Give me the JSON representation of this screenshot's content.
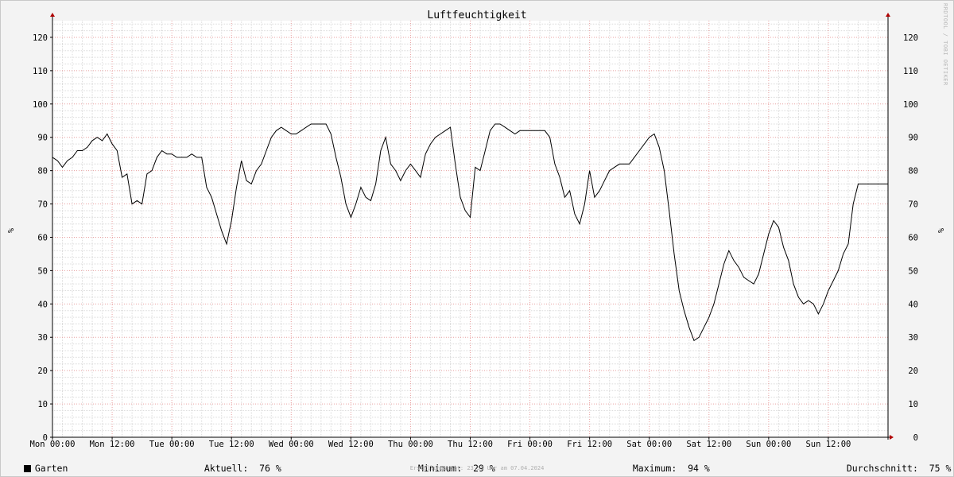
{
  "chart_data": {
    "type": "line",
    "title": "Luftfeuchtigkeit",
    "ylabel": "%",
    "xlabel": "",
    "ylim": [
      0,
      125
    ],
    "y_ticks": [
      0,
      10,
      20,
      30,
      40,
      50,
      60,
      70,
      80,
      90,
      100,
      110,
      120
    ],
    "x_ticks": [
      "Mon 00:00",
      "Mon 12:00",
      "Tue 00:00",
      "Tue 12:00",
      "Wed 00:00",
      "Wed 12:00",
      "Thu 00:00",
      "Thu 12:00",
      "Fri 00:00",
      "Fri 12:00",
      "Sat 00:00",
      "Sat 12:00",
      "Sun 00:00",
      "Sun 12:00"
    ],
    "x_unit": "hours since Mon 00:00",
    "xlim": [
      0,
      168
    ],
    "grid": true,
    "series": [
      {
        "name": "Garten",
        "color": "#000000",
        "x": [
          0,
          1,
          2,
          3,
          4,
          5,
          6,
          7,
          8,
          9,
          10,
          11,
          12,
          13,
          14,
          15,
          16,
          17,
          18,
          19,
          20,
          21,
          22,
          23,
          24,
          25,
          26,
          27,
          28,
          29,
          30,
          31,
          32,
          33,
          34,
          35,
          36,
          37,
          38,
          39,
          40,
          41,
          42,
          43,
          44,
          45,
          46,
          47,
          48,
          49,
          50,
          51,
          52,
          53,
          54,
          55,
          56,
          57,
          58,
          59,
          60,
          61,
          62,
          63,
          64,
          65,
          66,
          67,
          68,
          69,
          70,
          71,
          72,
          73,
          74,
          75,
          76,
          77,
          78,
          79,
          80,
          81,
          82,
          83,
          84,
          85,
          86,
          87,
          88,
          89,
          90,
          91,
          92,
          93,
          94,
          95,
          96,
          97,
          98,
          99,
          100,
          101,
          102,
          103,
          104,
          105,
          106,
          107,
          108,
          109,
          110,
          111,
          112,
          113,
          114,
          115,
          116,
          117,
          118,
          119,
          120,
          121,
          122,
          123,
          124,
          125,
          126,
          127,
          128,
          129,
          130,
          131,
          132,
          133,
          134,
          135,
          136,
          137,
          138,
          139,
          140,
          141,
          142,
          143,
          144,
          145,
          146,
          147,
          148,
          149,
          150,
          151,
          152,
          153,
          154,
          155,
          156,
          157,
          158,
          159,
          160,
          161,
          162,
          163,
          164,
          165,
          166,
          167,
          168
        ],
        "values": [
          84,
          83,
          81,
          83,
          84,
          86,
          86,
          87,
          89,
          90,
          89,
          91,
          88,
          86,
          78,
          79,
          70,
          71,
          70,
          79,
          80,
          84,
          86,
          85,
          85,
          84,
          84,
          84,
          85,
          84,
          84,
          75,
          72,
          67,
          62,
          58,
          65,
          75,
          83,
          77,
          76,
          80,
          82,
          86,
          90,
          92,
          93,
          92,
          91,
          91,
          92,
          93,
          94,
          94,
          94,
          94,
          91,
          84,
          78,
          70,
          66,
          70,
          75,
          72,
          71,
          76,
          86,
          90,
          82,
          80,
          77,
          80,
          82,
          80,
          78,
          85,
          88,
          90,
          91,
          92,
          93,
          82,
          72,
          68,
          66,
          81,
          80,
          86,
          92,
          94,
          94,
          93,
          92,
          91,
          92,
          92,
          92,
          92,
          92,
          92,
          90,
          82,
          78,
          72,
          74,
          67,
          64,
          70,
          80,
          72,
          74,
          77,
          80,
          81,
          82,
          82,
          82,
          84,
          86,
          88,
          90,
          91,
          87,
          80,
          68,
          55,
          44,
          38,
          33,
          29,
          30,
          33,
          36,
          40,
          46,
          52,
          56,
          53,
          51,
          48,
          47,
          46,
          49,
          55,
          61,
          65,
          63,
          57,
          53,
          46,
          42,
          40,
          41,
          40,
          37,
          40,
          44,
          47,
          50,
          55,
          58,
          70,
          76,
          76,
          76,
          76,
          76,
          76,
          76
        ]
      }
    ]
  },
  "legend": {
    "series_name": "Garten",
    "current_label": "Aktuell:",
    "current_value": "76 %",
    "min_label": "Minimum:",
    "min_value": "29 %",
    "max_label": "Maximum:",
    "max_value": "94 %",
    "avg_label": "Durchschnitt:",
    "avg_value": "75 %"
  },
  "footer": "Erstellungszeit: 23:55 Uhr am 07.04.2024",
  "watermark": "RRDTOOL / TOBI OETIKER",
  "colors": {
    "line": "#000000",
    "major_grid": "#e8a0a0",
    "minor_grid": "#dcdcdc",
    "axis": "#000000",
    "arrow": "#b00000",
    "background": "#f3f3f3",
    "plot_bg": "#ffffff"
  }
}
